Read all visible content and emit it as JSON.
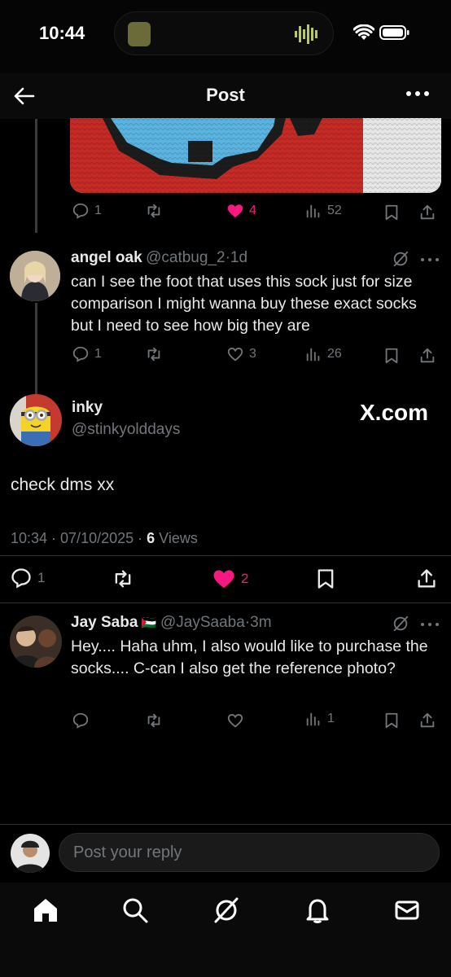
{
  "status_bar": {
    "time": "10:44"
  },
  "header": {
    "title": "Post"
  },
  "parent_post": {
    "actions": {
      "replies": "1",
      "likes": "4",
      "views": "52"
    }
  },
  "reply_1": {
    "name": "angel oak",
    "handle": "@catbug_2",
    "time": "1d",
    "text": "can I see the foot that uses this sock just for size comparison I might wanna buy these exact socks but I need to see how big they are",
    "actions": {
      "replies": "1",
      "likes": "3",
      "views": "26"
    }
  },
  "main_post": {
    "name": "inky",
    "handle": "@stinkyolddays",
    "watermark": "X.com",
    "text": "check dms xx",
    "timestamp": "10:34 · 07/10/2025 ·",
    "views_count": "6",
    "views_label": "Views",
    "actions": {
      "replies": "1",
      "likes": "2"
    }
  },
  "reply_2": {
    "name": "Jay Saba",
    "flag": "🇵🇸",
    "handle": "@JaySaaba",
    "time": "3m",
    "text": "Hey.... Haha uhm, I also would like to purchase the socks.... C-can I also get the reference photo?",
    "actions": {
      "views": "1"
    }
  },
  "composer": {
    "placeholder": "Post your reply"
  },
  "colors": {
    "like": "#f91880",
    "muted": "#71767b",
    "text": "#e7e9ea",
    "background": "#000000"
  }
}
